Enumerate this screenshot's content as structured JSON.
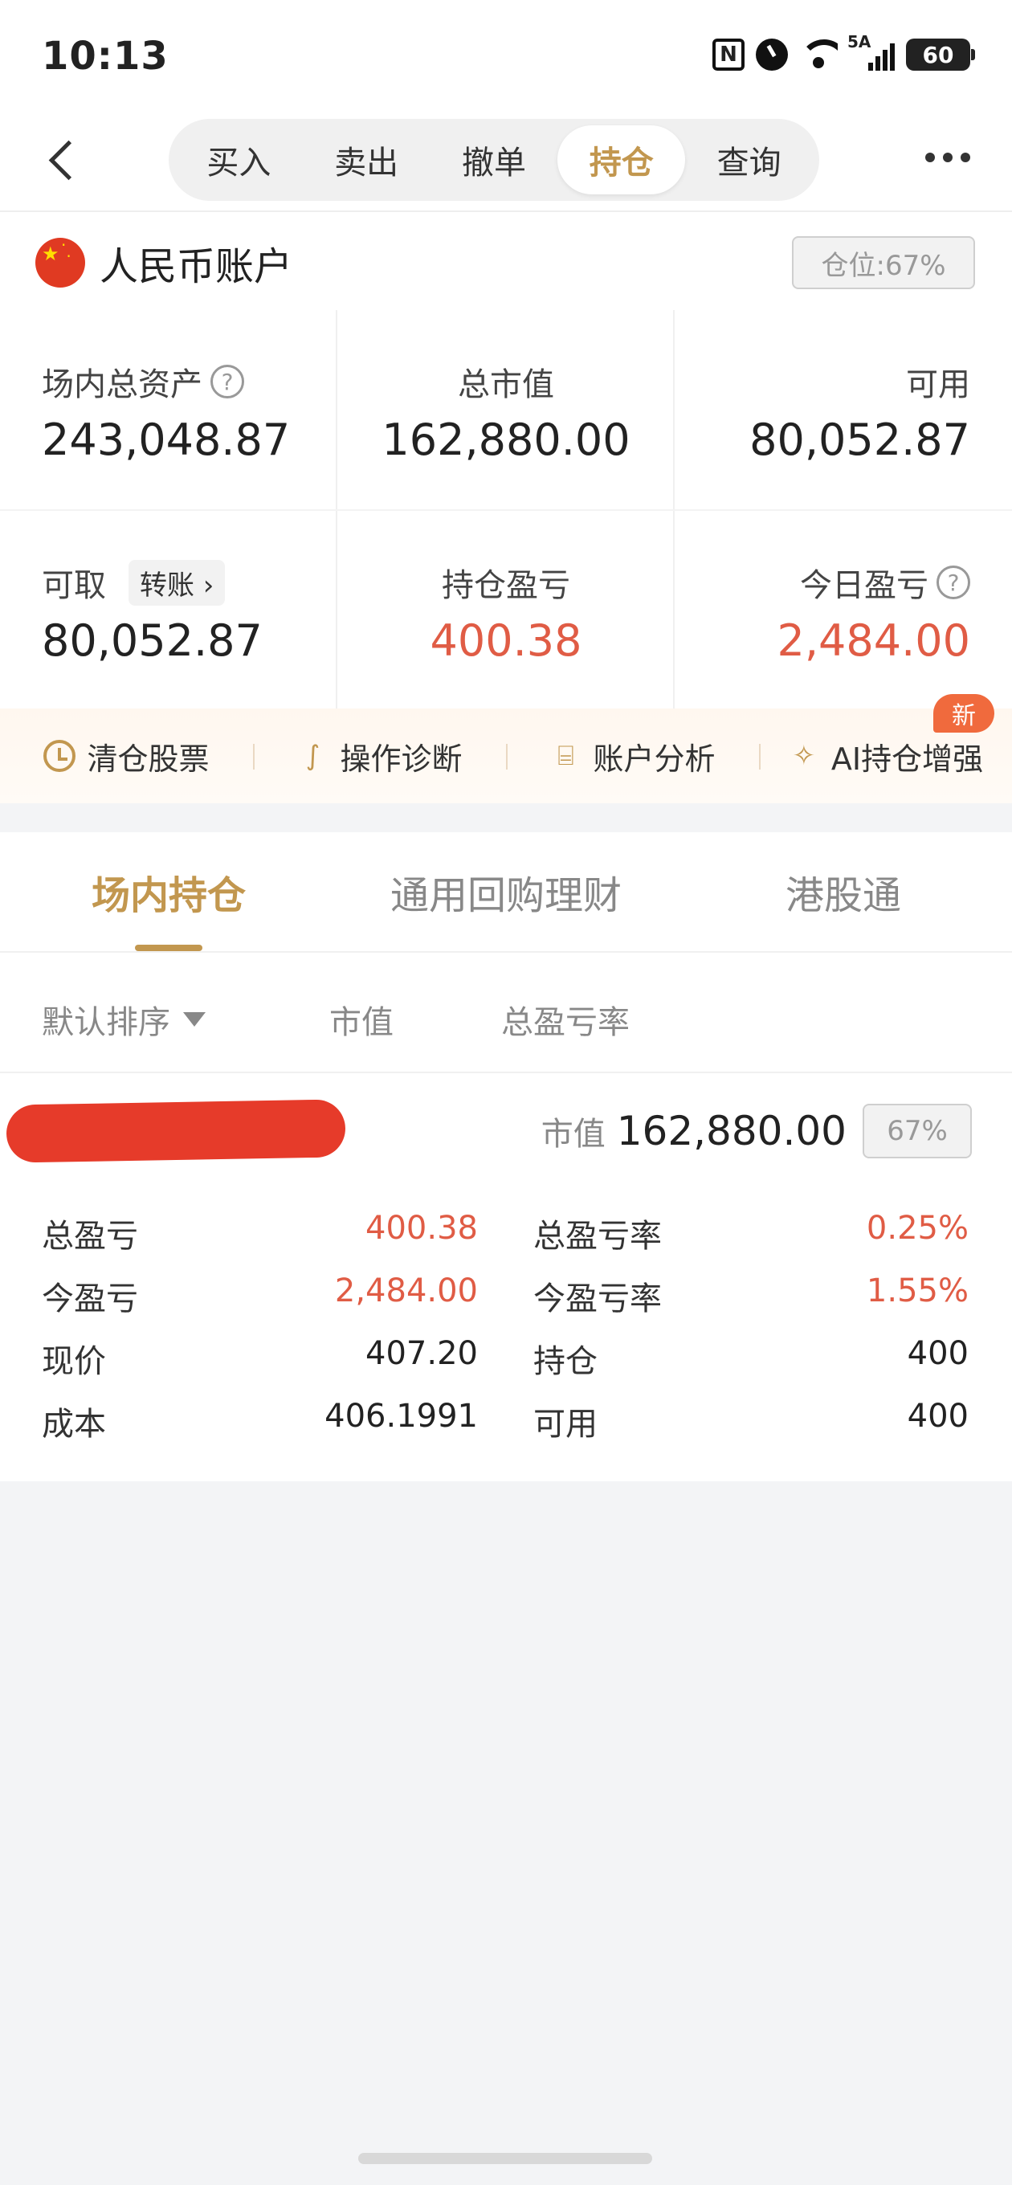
{
  "status": {
    "time": "10:13",
    "nfc": "N",
    "signal": "5A",
    "battery": "60"
  },
  "nav": {
    "tabs": [
      "买入",
      "卖出",
      "撤单",
      "持仓",
      "查询"
    ],
    "active_tab": "持仓"
  },
  "account": {
    "name": "人民币账户",
    "position_badge": "仓位:67%",
    "total_assets_label": "场内总资产",
    "total_assets_value": "243,048.87",
    "market_value_label": "总市值",
    "market_value_value": "162,880.00",
    "available_label": "可用",
    "available_value": "80,052.87",
    "withdrawable_label": "可取",
    "transfer_label": "转账",
    "withdrawable_value": "80,052.87",
    "position_pnl_label": "持仓盈亏",
    "position_pnl_value": "400.38",
    "today_pnl_label": "今日盈亏",
    "today_pnl_value": "2,484.00",
    "help_icon": "?"
  },
  "tools": {
    "items": [
      "清仓股票",
      "操作诊断",
      "账户分析",
      "AI持仓增强"
    ],
    "new_badge": "新"
  },
  "holding_tabs": {
    "items": [
      "场内持仓",
      "通用回购理财",
      "港股通"
    ],
    "active": "场内持仓"
  },
  "sort": {
    "default": "默认排序",
    "market_value": "市值",
    "total_rate": "总盈亏率"
  },
  "holding": {
    "mv_label": "市值",
    "mv_value": "162,880.00",
    "pct": "67%",
    "rows": [
      {
        "k1": "总盈亏",
        "v1": "400.38",
        "k2": "总盈亏率",
        "v2": "0.25%"
      },
      {
        "k1": "今盈亏",
        "v1": "2,484.00",
        "k2": "今盈亏率",
        "v2": "1.55%"
      },
      {
        "k1": "现价",
        "v1": "407.20",
        "k2": "持仓",
        "v2": "400"
      },
      {
        "k1": "成本",
        "v1": "406.1991",
        "k2": "可用",
        "v2": "400"
      }
    ]
  },
  "colors": {
    "accent": "#c2974f",
    "profit": "#e05c45",
    "redaction": "#e63b2a"
  }
}
